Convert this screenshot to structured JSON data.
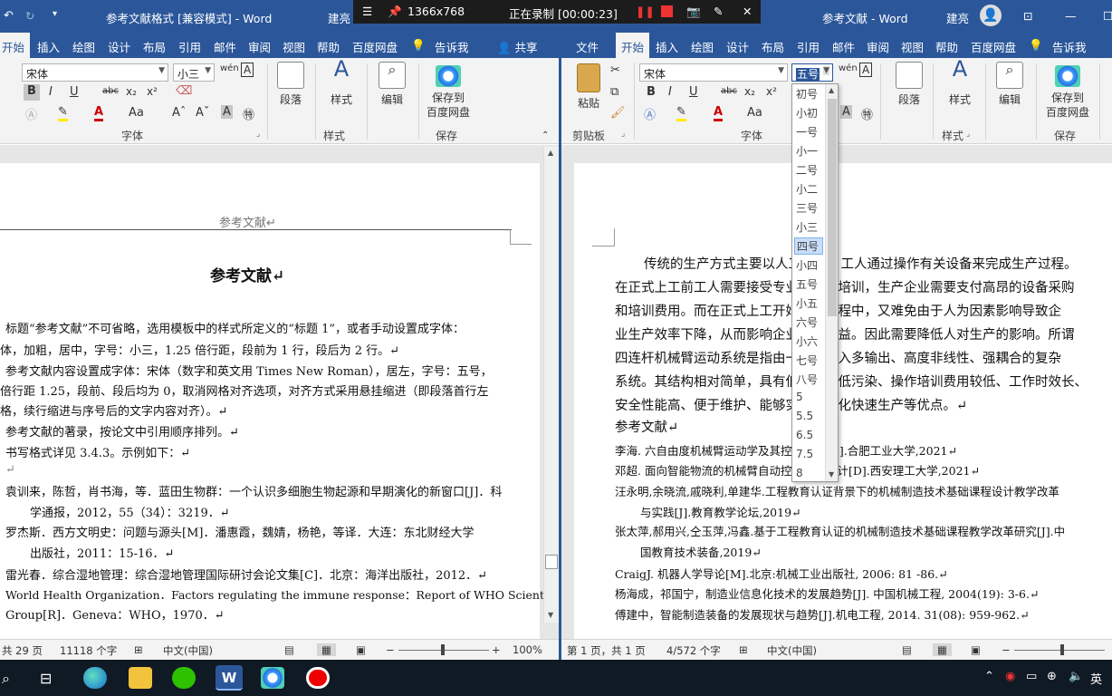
{
  "recorder": {
    "resolution": "1366x768",
    "status": "正在录制 [00:00:23]"
  },
  "left": {
    "title": "参考文献格式 [兼容模式] - Word",
    "user_short": "建亮",
    "tabs": [
      "开始",
      "插入",
      "绘图",
      "设计",
      "布局",
      "引用",
      "邮件",
      "审阅",
      "视图",
      "帮助",
      "百度网盘",
      "告诉我",
      "共享"
    ],
    "font_name": "宋体",
    "font_size": "小三",
    "format_glyphs": [
      "B",
      "I",
      "U",
      "abc",
      "x₂",
      "x²"
    ],
    "groups": {
      "font": "字体",
      "style": "样式",
      "save": "保存"
    },
    "buttons": {
      "para": "段落",
      "styles": "样式",
      "edit": "编辑",
      "save1": "保存到",
      "save2": "百度网盘"
    },
    "header": "参考文献↵",
    "heading": "参考文献↵",
    "lines": [
      "标题“参考文献”不可省略，选用模板中的样式所定义的“标题 1”，或者手动设置成字体：",
      "体，加粗，居中，字号：小三，1.25 倍行距，段前为 1 行，段后为 2 行。↵",
      "参考文献内容设置成字体：宋体（数字和英文用 Times New Roman），居左，字号：五号，",
      "倍行距 1.25，段前、段后均为 0，取消网格对齐选项，对齐方式采用悬挂缩进（即段落首行左",
      "格，续行缩进与序号后的文字内容对齐）。↵",
      "参考文献的著录，按论文中引用顺序排列。↵",
      "书写格式详见 3.4.3。示例如下：↵",
      "↵",
      "袁训来，陈哲，肖书海，等．蓝田生物群：一个认识多细胞生物起源和早期演化的新窗口[J]．科",
      "学通报，2012，55（34）：3219．↵",
      "罗杰斯．西方文明史：问题与源头[M]．潘惠霞，魏婧，杨艳，等译．大连：东北财经大学",
      "出版社，2011：15-16．↵",
      "雷光春．综合湿地管理：综合湿地管理国际研讨会论文集[C]．北京：海洋出版社，2012．↵",
      "World Health Organization．Factors regulating the immune response：Report of WHO Scientific",
      "Group[R]．Geneva：WHO，1970．↵"
    ],
    "status": {
      "pages": "共 29 页",
      "words": "11118 个字",
      "lang": "中文(中国)",
      "zoom": "100%"
    }
  },
  "right": {
    "title": "参考文献 - Word",
    "user": "建亮",
    "tabs": [
      "文件",
      "开始",
      "插入",
      "绘图",
      "设计",
      "布局",
      "引用",
      "邮件",
      "审阅",
      "视图",
      "帮助",
      "百度网盘",
      "告诉我"
    ],
    "font_name": "宋体",
    "font_size": "五号",
    "format_glyphs": [
      "B",
      "I",
      "U",
      "abc",
      "x₂",
      "x²"
    ],
    "groups": {
      "clipboard": "剪贴板",
      "font": "字体",
      "style": "样式",
      "save": "保存"
    },
    "buttons": {
      "paste": "粘贴",
      "para": "段落",
      "styles": "样式",
      "edit": "编辑",
      "save1": "保存到",
      "save2": "百度网盘"
    },
    "body": [
      "传统的生产方式主要以人工为主，工人通过操作有关设备来完成生产过程。",
      "在正式上工前工人需要接受专业的专业培训，生产企业需要支付高昂的设备采购",
      "和培训费用。而在正式上工开始后的过程中，又难免由于人为因素影响导致企",
      "业生产效率下降，从而影响企业经济效益。因此需要降低人对生产的影响。所谓",
      "四连杆机械臂运动系统是指由一个多输入多输出、高度非线性、强耦合的复杂",
      "系统。其结构相对简单，具有低能耗、低污染、操作培训费用较低、工作时效长、",
      "安全性能高、便于维护、能够实现模块化快速生产等优点。↵"
    ],
    "ref_title": "参考文献↵",
    "refs": [
      "李海. 六自由度机械臂运动学及其控制研究[D].合肥工业大学,2021↵",
      "邓超. 面向智能物流的机械臂自动控制系统设计[D].西安理工大学,2021↵",
      "汪永明,余晓流,戚晓利,单建华.工程教育认证背景下的机械制造技术基础课程设计教学改革",
      "与实践[J].教育教学论坛,2019↵",
      "张太萍,郝用兴,仝玉萍,冯鑫.基于工程教育认证的机械制造技术基础课程教学改革研究[J].中",
      "国教育技术装备,2019↵",
      "CraigJ. 机器人学导论[M].北京:机械工业出版社, 2006: 81 -86.↵",
      "杨海成，祁国宁，制造业信息化技术的发展趋势[J]. 中国机械工程, 2004(19): 3-6.↵",
      "傅建中，智能制造装备的发展现状与趋势[J].机电工程, 2014. 31(08): 959-962.↵"
    ],
    "font_sizes": [
      "初号",
      "小初",
      "一号",
      "小一",
      "二号",
      "小二",
      "三号",
      "小三",
      "四号",
      "小四",
      "五号",
      "小五",
      "六号",
      "小六",
      "七号",
      "八号",
      "5",
      "5.5",
      "6.5",
      "7.5",
      "8"
    ],
    "highlighted_size": "四号",
    "status": {
      "pages": "第 1 页，共 1 页",
      "words": "4/572 个字",
      "lang": "中文(中国)"
    }
  },
  "taskbar": {
    "lang": "英"
  }
}
